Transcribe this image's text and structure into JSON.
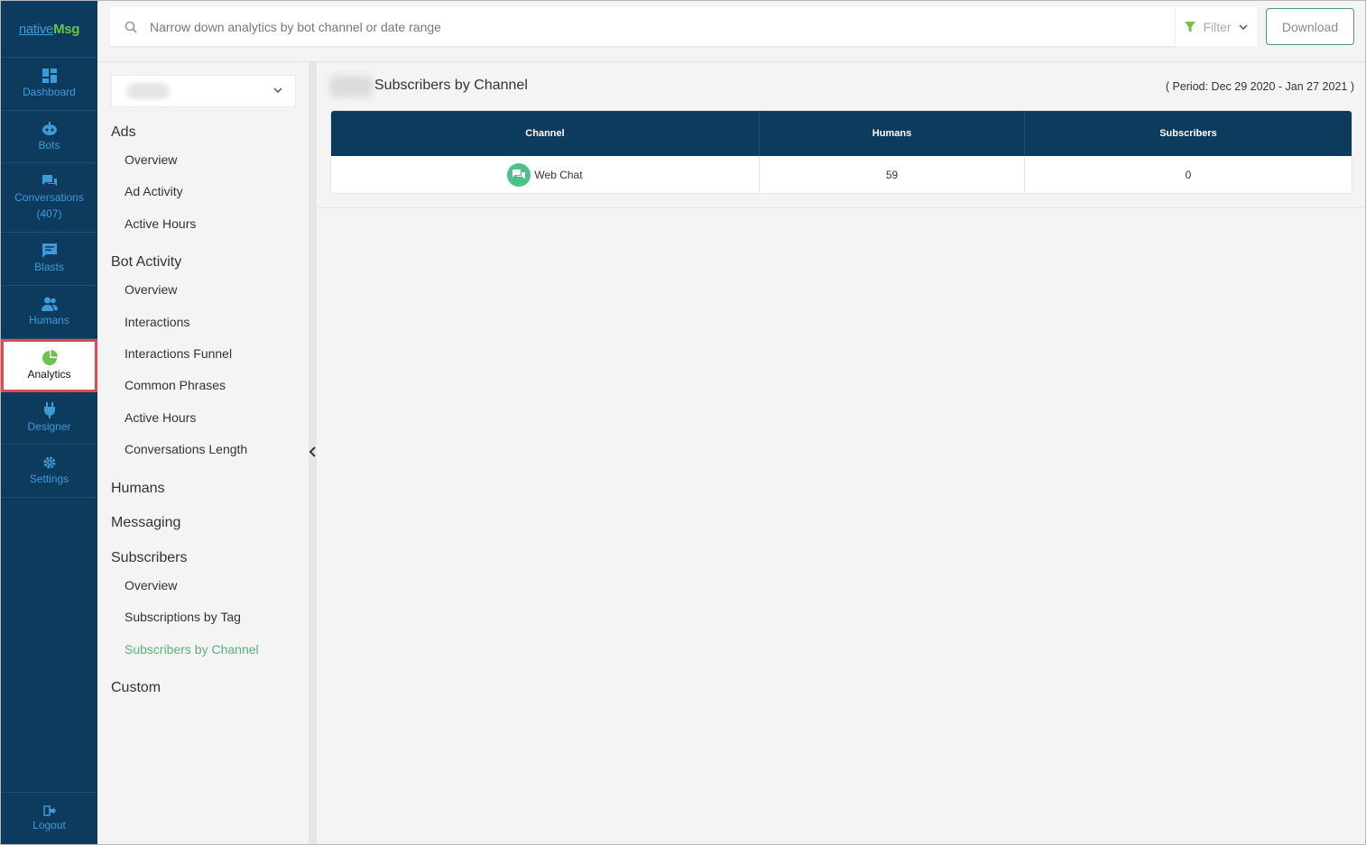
{
  "brand": {
    "logo_part1": "native",
    "logo_part2": "Msg"
  },
  "nav": {
    "items": [
      {
        "label": "Dashboard",
        "icon": "dashboard-icon"
      },
      {
        "label": "Bots",
        "icon": "bot-icon"
      },
      {
        "label": "Conversations",
        "sub": "(407)",
        "icon": "conversations-icon"
      },
      {
        "label": "Blasts",
        "icon": "blast-icon"
      },
      {
        "label": "Humans",
        "icon": "humans-icon"
      },
      {
        "label": "Analytics",
        "icon": "pie-chart-icon",
        "active": true
      },
      {
        "label": "Designer",
        "icon": "plug-icon"
      },
      {
        "label": "Settings",
        "icon": "gear-icon"
      }
    ],
    "logout": "Logout"
  },
  "topbar": {
    "search_placeholder": "Narrow down analytics by bot channel or date range",
    "filter_label": "Filter",
    "download_label": "Download"
  },
  "subnav": {
    "ads": {
      "title": "Ads",
      "links": [
        "Overview",
        "Ad Activity",
        "Active Hours"
      ]
    },
    "bot_activity": {
      "title": "Bot Activity",
      "links": [
        "Overview",
        "Interactions",
        "Interactions Funnel",
        "Common Phrases",
        "Active Hours",
        "Conversations Length"
      ]
    },
    "humans": {
      "title": "Humans"
    },
    "messaging": {
      "title": "Messaging"
    },
    "subscribers": {
      "title": "Subscribers",
      "links": [
        "Overview",
        "Subscriptions by Tag",
        "Subscribers by Channel"
      ],
      "current": "Subscribers by Channel"
    },
    "custom": {
      "title": "Custom"
    }
  },
  "main": {
    "title": "Subscribers by Channel",
    "period": "( Period: Dec 29 2020 - Jan 27 2021 )",
    "table": {
      "headers": [
        "Channel",
        "Humans",
        "Subscribers"
      ],
      "rows": [
        {
          "channel": "Web Chat",
          "humans": "59",
          "subscribers": "0"
        }
      ]
    }
  },
  "colors": {
    "nav_bg": "#0d3b5e",
    "nav_text": "#3d9bd8",
    "accent_green": "#5bb07b",
    "active_border": "#e6484f"
  }
}
